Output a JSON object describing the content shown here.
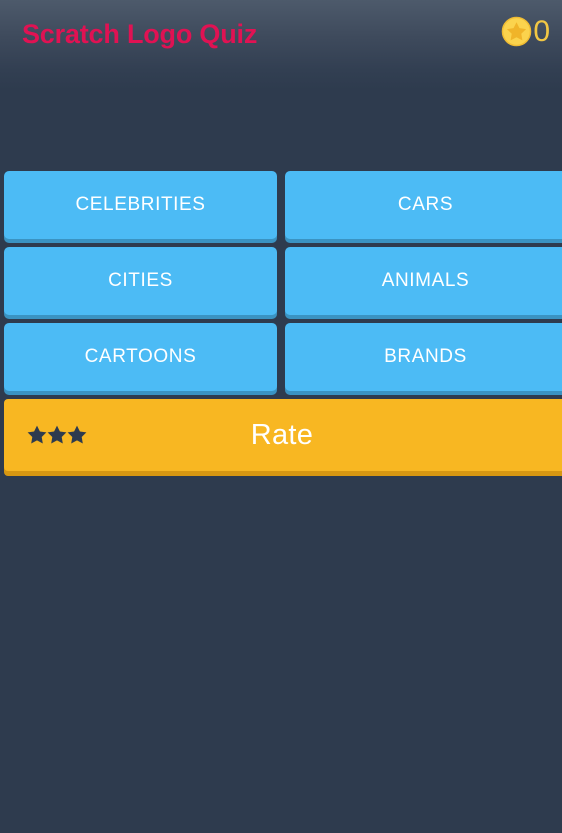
{
  "header": {
    "title": "Scratch Logo Quiz",
    "coin_icon": "star-coin-icon",
    "score": "0",
    "title_color": "#e01253",
    "score_color": "#f2c744"
  },
  "categories": {
    "rows": [
      [
        {
          "label": "CELEBRITIES",
          "name": "category-button-celebrities"
        },
        {
          "label": "CARS",
          "name": "category-button-cars"
        }
      ],
      [
        {
          "label": "CITIES",
          "name": "category-button-cities"
        },
        {
          "label": "ANIMALS",
          "name": "category-button-animals"
        }
      ],
      [
        {
          "label": "CARTOONS",
          "name": "category-button-cartoons"
        },
        {
          "label": "BRANDS",
          "name": "category-button-brands"
        }
      ]
    ],
    "button_color": "#4cbbf5",
    "button_shadow_color": "#3a93c2"
  },
  "rate": {
    "label": "Rate",
    "stars_icon": "three-stars-icon",
    "star_count": 3,
    "banner_color": "#f8b722",
    "banner_shadow_color": "#d79712",
    "star_color": "#2e3b4e"
  },
  "background": {
    "color": "#2e3b4e",
    "header_gradient_top": "#4d5a6b"
  }
}
